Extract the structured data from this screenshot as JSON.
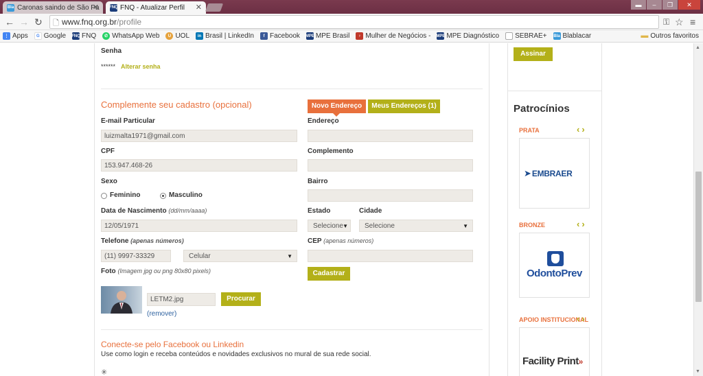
{
  "browser": {
    "tabs": [
      {
        "title": "Caronas saindo de São Pa",
        "favicon": "bla-bla-icon"
      },
      {
        "title": "FNQ - Atualizar Perfil",
        "favicon": "fnq-icon"
      }
    ],
    "url_host": "www.fnq.org.br",
    "url_path": "/profile",
    "bookmarks": [
      {
        "label": "Apps",
        "icon": "apps-icon",
        "color": "#4285f4"
      },
      {
        "label": "Google",
        "icon": "google-icon",
        "color": "#4285f4"
      },
      {
        "label": "FNQ",
        "icon": "fnq-icon",
        "color": "#1b3c7a"
      },
      {
        "label": "WhatsApp Web",
        "icon": "whatsapp-icon",
        "color": "#25d366"
      },
      {
        "label": "UOL",
        "icon": "uol-icon",
        "color": "#e6a23c"
      },
      {
        "label": "Brasil | LinkedIn",
        "icon": "linkedin-icon",
        "color": "#0077b5"
      },
      {
        "label": "Facebook",
        "icon": "facebook-icon",
        "color": "#3b5998"
      },
      {
        "label": "MPE Brasil",
        "icon": "mpe-icon",
        "color": "#1b3c7a"
      },
      {
        "label": "Mulher de Negócios -",
        "icon": "mulher-icon",
        "color": "#c0392b"
      },
      {
        "label": "MPE Diagnóstico",
        "icon": "mpe-icon",
        "color": "#1b3c7a"
      },
      {
        "label": "SEBRAE+",
        "icon": "page-icon",
        "color": "#888888"
      },
      {
        "label": "Blablacar",
        "icon": "bla-bla-icon",
        "color": "#3a9ad9"
      }
    ],
    "other_bookmarks": "Outros favoritos"
  },
  "profile": {
    "senha_label": "Senha",
    "senha_mask": "******",
    "alterar_senha": "Alterar senha",
    "complement_title": "Complemente seu cadastro (opcional)",
    "email_label": "E-mail Particular",
    "email_value": "luizmalta1971@gmail.com",
    "cpf_label": "CPF",
    "cpf_value": "153.947.468-26",
    "sexo_label": "Sexo",
    "feminino": "Feminino",
    "masculino": "Masculino",
    "nascimento_label": "Data de Nascimento",
    "nascimento_hint": "(dd/mm/aaaa)",
    "nascimento_value": "12/05/1971",
    "telefone_label": "Telefone",
    "telefone_hint": "(apenas números)",
    "telefone_value": "(11) 9997-33329",
    "telefone_type": "Celular",
    "foto_label": "Foto",
    "foto_hint": "(Imagem jpg ou png 80x80 pixels)",
    "foto_file": "LETM2.jpg",
    "procurar": "Procurar",
    "remover": "(remover)",
    "novo_endereco": "Novo Endereço",
    "meus_enderecos": "Meus Endereços (1)",
    "endereco_label": "Endereço",
    "complemento_label": "Complemento",
    "bairro_label": "Bairro",
    "estado_label": "Estado",
    "estado_value": "Selecione",
    "cidade_label": "Cidade",
    "cidade_value": "Selecione",
    "cep_label": "CEP",
    "cep_hint": "(apenas números)",
    "cadastrar": "Cadastrar",
    "social_title": "Conecte-se pelo Facebook ou Linkedin",
    "social_desc": "Use como login e receba conteúdos e novidades exclusivos no mural de sua rede social."
  },
  "sidebar": {
    "assinar": "Assinar",
    "patrocinios": "Patrocínios",
    "sponsors": [
      {
        "category": "PRATA",
        "logo": "EMBRAER"
      },
      {
        "category": "BRONZE",
        "logo": "OdontoPrev"
      },
      {
        "category": "APOIO INSTITUCIONAL",
        "logo": "Facility Print"
      }
    ]
  },
  "colors": {
    "accent_orange": "#e8703c",
    "accent_olive": "#b3b019",
    "field_bg": "#eeebe6"
  }
}
